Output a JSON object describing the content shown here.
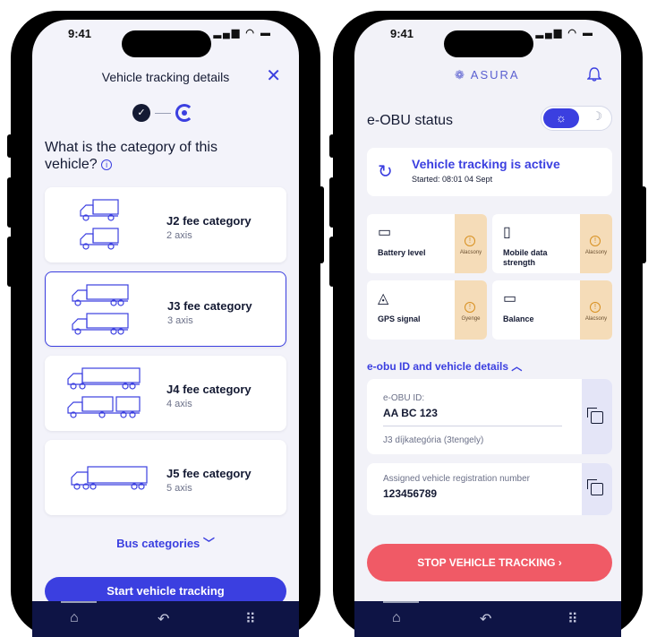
{
  "left_phone": {
    "status": {
      "time": "9:41",
      "icons": "▂▄▆ ◠ ▬"
    },
    "header": {
      "title": "Vehicle tracking details",
      "close_icon": "✕"
    },
    "stepper": {
      "done_mark": "✓"
    },
    "question": "What is the category of this vehicle?",
    "info_icon": "i",
    "categories": [
      {
        "name": "J2 fee category",
        "axis": "2 axis"
      },
      {
        "name": "J3 fee category",
        "axis": "3 axis"
      },
      {
        "name": "J4 fee category",
        "axis": "4 axis"
      },
      {
        "name": "J5 fee category",
        "axis": "5 axis"
      }
    ],
    "bus_link": "Bus categories ﹀",
    "start_button": "Start vehicle tracking",
    "nav": {
      "home": "⌂",
      "back": "↶",
      "menu": "⠿"
    }
  },
  "right_phone": {
    "status": {
      "time": "9:41",
      "icons": "▂▄▆ ◠ ▬"
    },
    "logo": "❁ ASURA",
    "section_title": "e-OBU status",
    "toggle": {
      "on": "☼",
      "off": "☽"
    },
    "tracking": {
      "icon": "↻",
      "title": "Vehicle tracking is active",
      "started": "Started: 08:01 04 Sept"
    },
    "tiles": [
      {
        "label": "Battery level",
        "status": "Alacsony",
        "icon": "▭"
      },
      {
        "label": "Mobile data strength",
        "status": "Alacsony",
        "icon": "▯"
      },
      {
        "label": "GPS signal",
        "status": "Gyenge",
        "icon": "◬"
      },
      {
        "label": "Balance",
        "status": "Alacsony",
        "icon": "▭"
      }
    ],
    "details_header": "e-obu ID and vehicle details ︿",
    "obu": {
      "label": "e-OBU ID:",
      "value": "AA BC 123",
      "category": "J3 díjkategória (3tengely)"
    },
    "registration": {
      "label": "Assigned vehicle registration number",
      "value": "123456789"
    },
    "stop_button": "STOP VEHICLE TRACKING  ›",
    "nav": {
      "home": "⌂",
      "back": "↶",
      "menu": "⠿"
    }
  },
  "colors": {
    "accent": "#3b3fe0",
    "navy": "#0e1445",
    "warn_bg": "#f5dcb8",
    "stop": "#f05a66"
  }
}
